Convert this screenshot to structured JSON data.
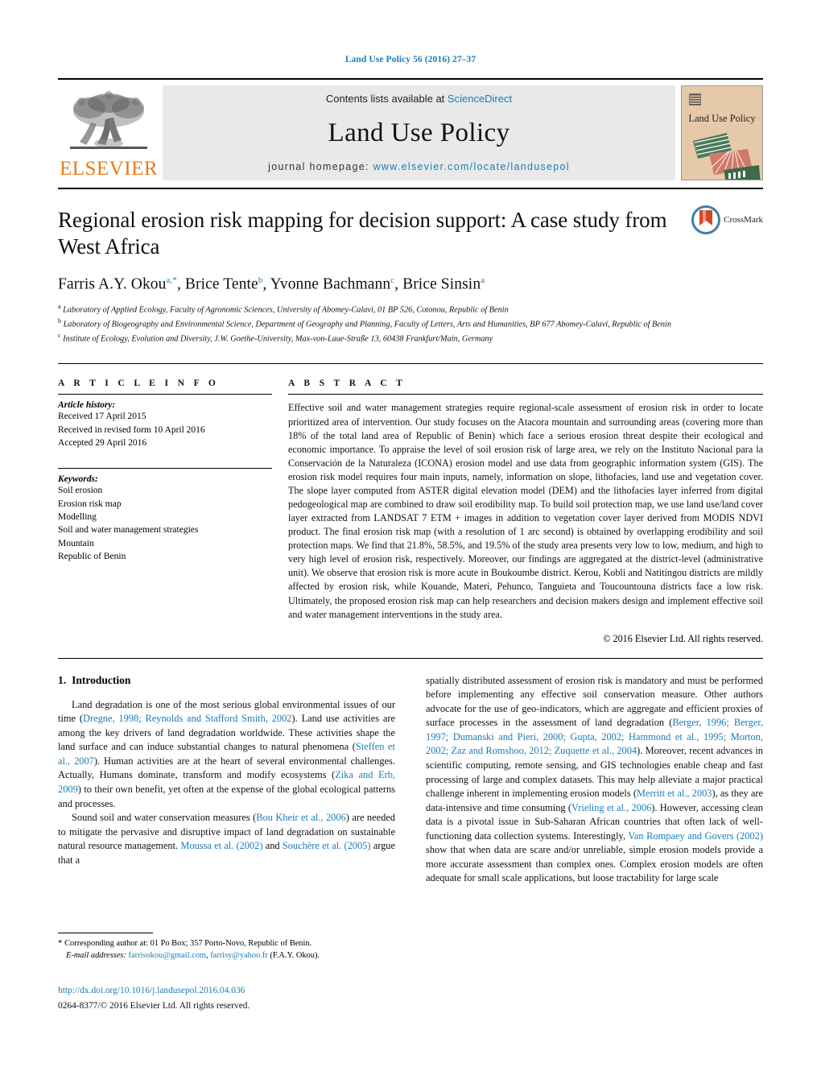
{
  "running_head": "Land Use Policy 56 (2016) 27–37",
  "masthead": {
    "publisher_name": "ELSEVIER",
    "contents_prefix": "Contents lists available at ",
    "contents_link": "ScienceDirect",
    "journal_title": "Land Use Policy",
    "homepage_prefix": "journal homepage: ",
    "homepage_link": "www.elsevier.com/locate/landusepol",
    "cover_title": "Land Use Policy"
  },
  "article": {
    "title": "Regional erosion risk mapping for decision support: A case study from West Africa",
    "crossmark_label": "CrossMark",
    "authors_html": "Farris A.Y. Okou<sup>a,*</sup>, Brice Tente<sup>b</sup>, Yvonne Bachmann<sup>c</sup>, Brice Sinsin<sup>a</sup>",
    "affiliations": [
      {
        "marker": "a",
        "text": "Laboratory of Applied Ecology, Faculty of Agronomic Sciences, University of Abomey-Calavi, 01 BP 526, Cotonou, Republic of Benin"
      },
      {
        "marker": "b",
        "text": "Laboratory of Biogeography and Environmental Science, Department of Geography and Planning, Faculty of Letters, Arts and Humanities, BP 677 Abomey-Calavi, Republic of Benin"
      },
      {
        "marker": "c",
        "text": "Institute of Ecology, Evolution and Diversity, J.W. Goethe-University, Max-von-Laue-Straße 13, 60438 Frankfurt/Main, Germany"
      }
    ]
  },
  "article_info": {
    "heading": "A R T I C L E   I N F O",
    "history_label": "Article history:",
    "history": [
      "Received 17 April 2015",
      "Received in revised form 10 April 2016",
      "Accepted 29 April 2016"
    ],
    "keywords_label": "Keywords:",
    "keywords": [
      "Soil erosion",
      "Erosion risk map",
      "Modelling",
      "Soil and water management strategies",
      "Mountain",
      "Republic of Benin"
    ]
  },
  "abstract": {
    "heading": "A B S T R A C T",
    "text": "Effective soil and water management strategies require regional-scale assessment of erosion risk in order to locate prioritized area of intervention. Our study focuses on the Atacora mountain and surrounding areas (covering more than 18% of the total land area of Republic of Benin) which face a serious erosion threat despite their ecological and economic importance. To appraise the level of soil erosion risk of large area, we rely on the Instituto Nacional para la Conservación de la Naturaleza (ICONA) erosion model and use data from geographic information system (GIS). The erosion risk model requires four main inputs, namely, information on slope, lithofacies, land use and vegetation cover. The slope layer computed from ASTER digital elevation model (DEM) and the lithofacies layer inferred from digital pedogeological map are combined to draw soil erodibility map. To build soil protection map, we use land use/land cover layer extracted from LANDSAT 7 ETM + images in addition to vegetation cover layer derived from MODIS NDVI product. The final erosion risk map (with a resolution of 1 arc second) is obtained by overlapping erodibility and soil protection maps. We find that 21.8%, 58.5%, and 19.5% of the study area presents very low to low, medium, and high to very high level of erosion risk, respectively. Moreover, our findings are aggregated at the district-level (administrative unit). We observe that erosion risk is more acute in Boukoumbe district. Kerou, Kobli and Natitingou districts are mildly affected by erosion risk, while Kouande, Materi, Pehunco, Tanguieta and Toucountouna districts face a low risk. Ultimately, the proposed erosion risk map can help researchers and decision makers design and implement effective soil and water management interventions in the study area.",
    "copyright": "© 2016 Elsevier Ltd. All rights reserved."
  },
  "introduction": {
    "number": "1.",
    "heading": "Introduction",
    "left_paragraphs": [
      {
        "runs": [
          {
            "t": "Land degradation is one of the most serious global environmental issues of our time (",
            "c": "k"
          },
          {
            "t": "Dregne, 1998; Reynolds and Stafford Smith, 2002",
            "c": "l"
          },
          {
            "t": "). Land use activities are among the key drivers of land degradation worldwide. These activities shape the land surface and can induce substantial changes to natural phenomena (",
            "c": "k"
          },
          {
            "t": "Steffen et al., 2007",
            "c": "l"
          },
          {
            "t": "). Human activities are at the heart of several environmental challenges. Actually, Humans dominate, transform and modify ecosystems (",
            "c": "k"
          },
          {
            "t": "Zika and Erb, 2009",
            "c": "l"
          },
          {
            "t": ") to their own benefit, yet often at the expense of the global ecological patterns and processes.",
            "c": "k"
          }
        ]
      },
      {
        "runs": [
          {
            "t": "Sound soil and water conservation measures (",
            "c": "k"
          },
          {
            "t": "Bou Kheir et al., 2006",
            "c": "l"
          },
          {
            "t": ") are needed to mitigate the pervasive and disruptive impact of land degradation on sustainable natural resource management. ",
            "c": "k"
          },
          {
            "t": "Moussa et al. (2002)",
            "c": "l"
          },
          {
            "t": " and ",
            "c": "k"
          },
          {
            "t": "Souchère et al. (2005)",
            "c": "l"
          },
          {
            "t": " argue that a",
            "c": "k"
          }
        ]
      }
    ],
    "right_paragraphs": [
      {
        "runs": [
          {
            "t": "spatially distributed assessment of erosion risk is mandatory and must be performed before implementing any effective soil conservation measure. Other authors advocate for the use of geo-indicators, which are aggregate and efficient proxies of surface processes in the assessment of land degradation (",
            "c": "k"
          },
          {
            "t": "Berger, 1996; Berger, 1997; Dumanski and Pieri, 2000; Gupta, 2002; Hammond et al., 1995; Morton, 2002; Zaz and Romshoo, 2012; Zuquette et al., 2004",
            "c": "l"
          },
          {
            "t": "). Moreover, recent advances in scientific computing, remote sensing, and GIS technologies enable cheap and fast processing of large and complex datasets. This may help alleviate a major practical challenge inherent in implementing erosion models (",
            "c": "k"
          },
          {
            "t": "Merritt et al., 2003",
            "c": "l"
          },
          {
            "t": "), as they are data-intensive and time consuming (",
            "c": "k"
          },
          {
            "t": "Vrieling et al., 2006",
            "c": "l"
          },
          {
            "t": "). However, accessing clean data is a pivotal issue in Sub-Saharan African countries that often lack of well-functioning data collection systems. Interestingly, ",
            "c": "k"
          },
          {
            "t": "Van Rompaey and Govers (2002)",
            "c": "l"
          },
          {
            "t": " show that when data are scare and/or unreliable, simple erosion models provide a more accurate assessment than complex ones. Complex erosion models are often adequate for small scale applications, but loose tractability for large scale",
            "c": "k"
          }
        ]
      }
    ]
  },
  "footnote": {
    "star": "*",
    "corresponding": "Corresponding author at: 01 Po Box; 357 Porto-Novo, Republic of Benin.",
    "email_label": "E-mail addresses:",
    "email1": "farrisokou@gmail.com",
    "email_sep": ", ",
    "email2": "farrisy@yahoo.fr",
    "email_suffix": " (F.A.Y. Okou)."
  },
  "doi_block": {
    "doi_url": "http://dx.doi.org/10.1016/j.landusepol.2016.04.036",
    "issn_line": "0264-8377/© 2016 Elsevier Ltd. All rights reserved."
  },
  "colors": {
    "link": "#1a7db6",
    "elsevier_orange": "#E77B1C",
    "band_gray": "#e9e9e9",
    "cover_tan": "#e5c9a8"
  }
}
